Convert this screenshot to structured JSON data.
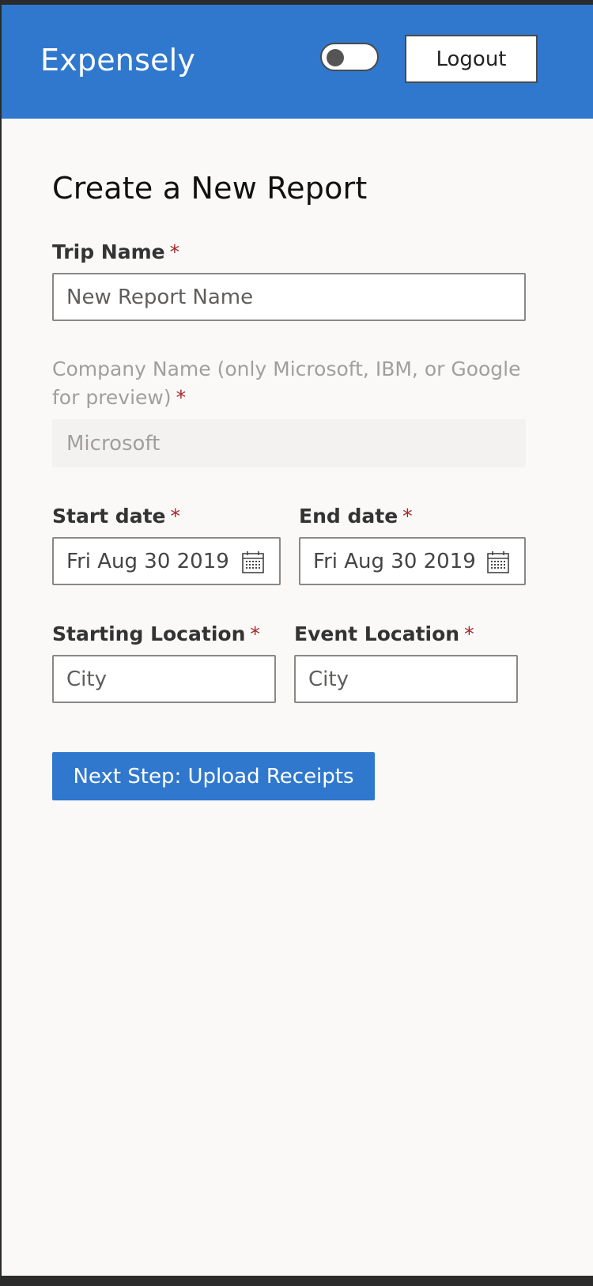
{
  "header": {
    "brand": "Expensely",
    "logout_label": "Logout",
    "theme_toggle_on": false
  },
  "form": {
    "title": "Create a New Report",
    "required_marker": "*",
    "trip_name": {
      "label": "Trip Name",
      "placeholder": "New Report Name",
      "value": ""
    },
    "company_name": {
      "label": "Company Name (only Microsoft, IBM, or Google for preview)",
      "value": "Microsoft",
      "disabled": true
    },
    "start_date": {
      "label": "Start date",
      "value": "Fri Aug 30 2019"
    },
    "end_date": {
      "label": "End date",
      "value": "Fri Aug 30 2019"
    },
    "starting_location": {
      "label": "Starting Location",
      "placeholder": "City"
    },
    "event_location": {
      "label": "Event Location",
      "placeholder": "City"
    },
    "next_button_label": "Next Step: Upload Receipts"
  },
  "colors": {
    "brand_blue": "#2f78cd",
    "required_red": "#a4262c",
    "background": "#faf9f8"
  },
  "icons": {
    "calendar": "calendar-icon"
  }
}
